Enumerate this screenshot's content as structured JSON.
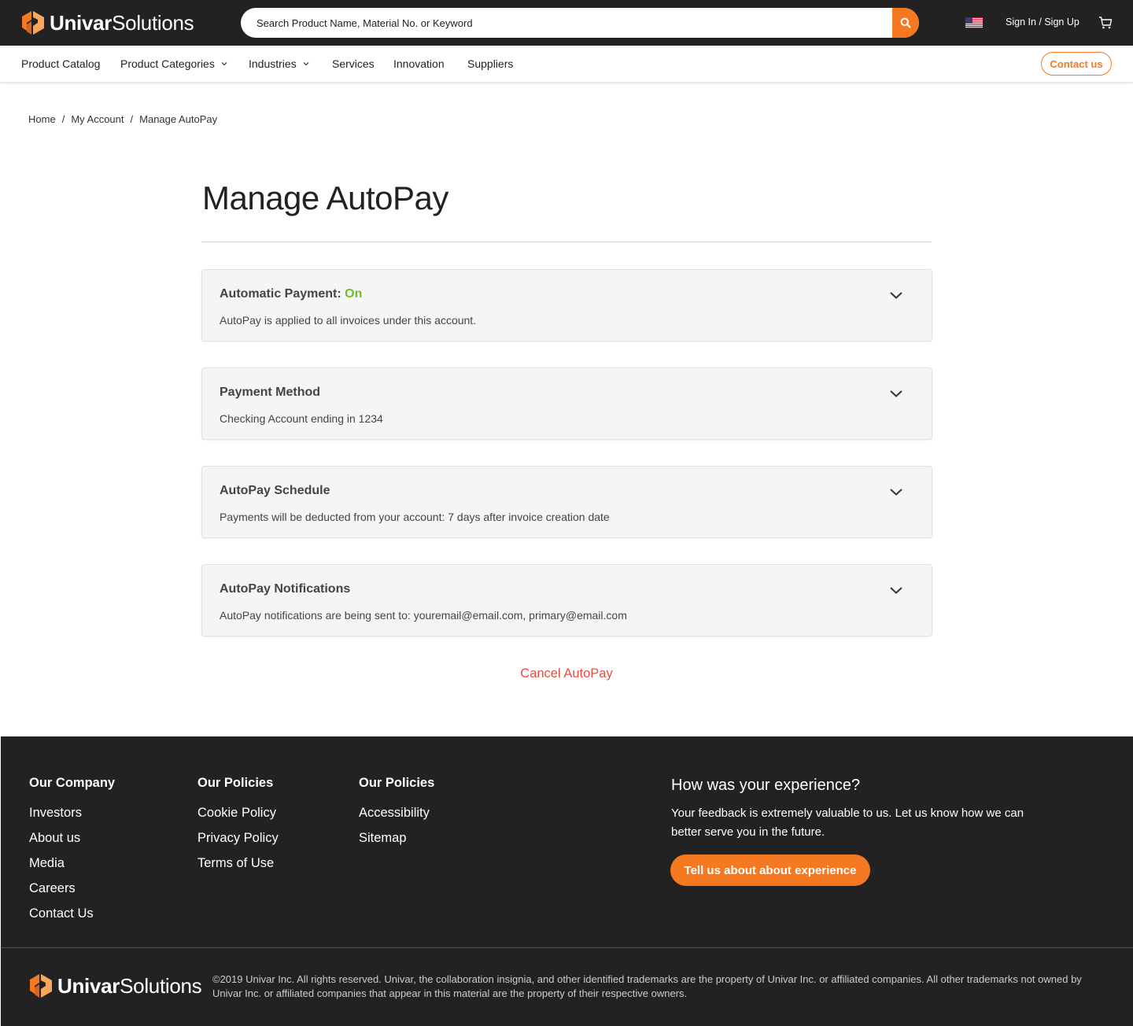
{
  "brand": {
    "name_bold": "Univar",
    "name_light": "Solutions",
    "color_primary": "#f47920",
    "color_dark": "#222222"
  },
  "header": {
    "search_placeholder": "Search Product Name, Material No. or Keyword",
    "flag_icon": "us-flag-icon",
    "signin_label": "Sign In / Sign Up",
    "cart_icon": "cart-icon"
  },
  "nav": {
    "items": [
      {
        "label": "Product Catalog"
      },
      {
        "label": "Product Categories",
        "dropdown": true
      },
      {
        "label": "Industries",
        "dropdown": true
      },
      {
        "label": "Services"
      },
      {
        "label": "Innovation"
      },
      {
        "label": "Suppliers"
      }
    ],
    "contact_label": "Contact us"
  },
  "breadcrumb": [
    "Home",
    "My Account",
    "Manage AutoPay"
  ],
  "breadcrumb_separator": "/",
  "main": {
    "title": "Manage AutoPay",
    "cards": [
      {
        "title": "Automatic Payment: ",
        "status": "On",
        "status_color": "#6bbf2a",
        "description": "AutoPay is applied to all invoices under this account."
      },
      {
        "title": "Payment Method",
        "description": "Checking Account ending in 1234"
      },
      {
        "title": "AutoPay Schedule",
        "description": "Payments will be deducted from your account: 7 days after invoice creation date"
      },
      {
        "title": "AutoPay Notifications",
        "description": "AutoPay notifications are being sent to: youremail@email.com, primary@email.com"
      }
    ],
    "cancel_label": "Cancel AutoPay",
    "cancel_color": "#e94b3c"
  },
  "footer": {
    "columns": [
      {
        "heading": "Our Company",
        "links": [
          "Investors",
          "About us",
          "Media",
          "Careers",
          "Contact Us"
        ]
      },
      {
        "heading": "Our Policies",
        "links": [
          "Cookie Policy",
          "Privacy Policy",
          "Terms of Use"
        ]
      },
      {
        "heading": "Our Policies",
        "links": [
          "Accessibility",
          "Sitemap"
        ]
      }
    ],
    "feedback": {
      "title": "How was your experience?",
      "text": "Your feedback is extremely valuable to us. Let us know how we can better serve you in the future.",
      "button_label": "Tell us about about experience"
    },
    "copyright": "©2019 Univar Inc. All rights reserved. Univar, the collaboration insignia, and other identified trademarks are the property of Univar Inc. or affiliated companies. All other trademarks not owned by Univar Inc. or affiliated companies that appear in this material are the property of their respective owners."
  }
}
